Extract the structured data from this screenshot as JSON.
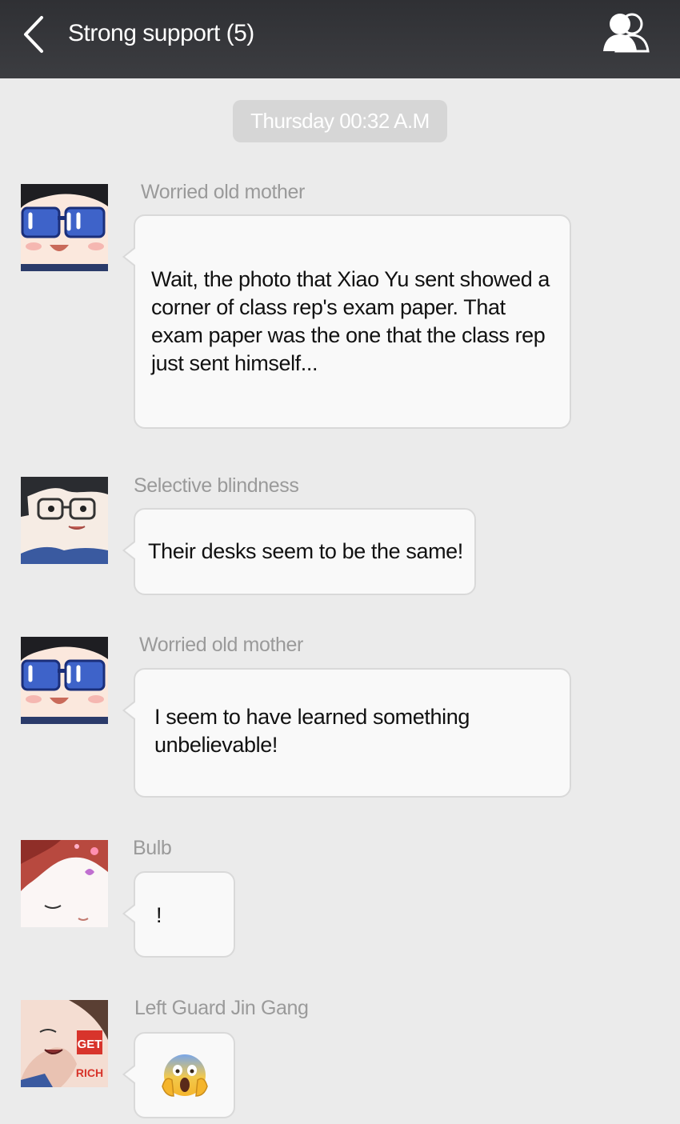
{
  "header": {
    "title": "Strong support (5)",
    "back_icon": "chevron-left-icon",
    "members_icon": "group-members-icon"
  },
  "timestamp": "Thursday 00:32 A.M",
  "messages": [
    {
      "sender": "Worried old mother",
      "avatar": "sunglasses-avatar",
      "text": "Wait, the photo that Xiao Yu sent showed a corner of class rep's exam paper. That exam paper was the one that the class rep just sent himself..."
    },
    {
      "sender": "Selective blindness",
      "avatar": "glasses-boy-avatar",
      "text": "Their desks seem to be the same!"
    },
    {
      "sender": "Worried old mother",
      "avatar": "sunglasses-avatar",
      "text": "I seem to have learned something unbelievable!"
    },
    {
      "sender": "Bulb",
      "avatar": "red-hair-avatar",
      "text": "!"
    },
    {
      "sender": "Left Guard Jin Gang",
      "avatar": "get-rich-avatar",
      "avatar_text": [
        "GET",
        "RICH"
      ],
      "emoji": "screaming-face-emoji"
    }
  ],
  "colors": {
    "header_bg": "#35363a",
    "chat_bg": "#ebebeb",
    "bubble_bg": "#f9f9f9",
    "timestamp_bg": "#d6d6d6",
    "sender_text": "#9a9a9a"
  }
}
